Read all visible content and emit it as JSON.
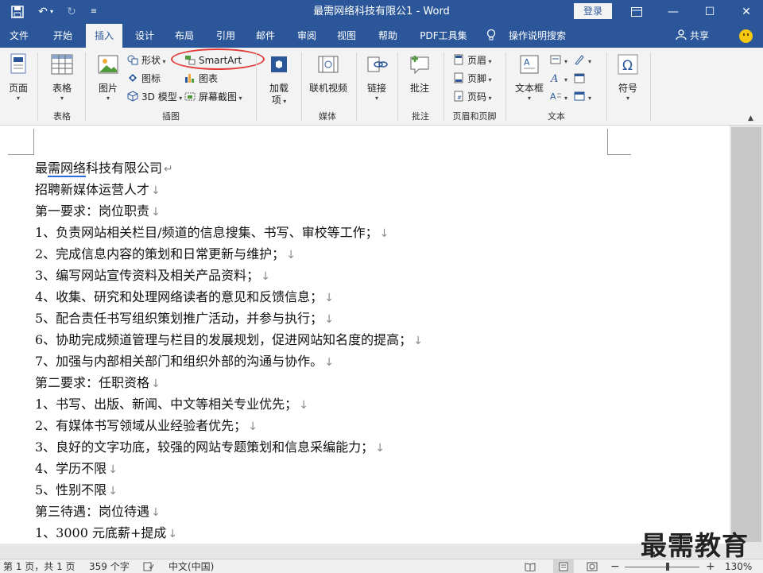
{
  "titlebar": {
    "title": "最需网络科技有限公1  -  Word",
    "login": "登录"
  },
  "tabs": [
    "文件",
    "开始",
    "插入",
    "设计",
    "布局",
    "引用",
    "邮件",
    "审阅",
    "视图",
    "帮助",
    "PDF工具集"
  ],
  "tell_me": "操作说明搜索",
  "share": "共享",
  "ribbon": {
    "pages": "页面",
    "table": "表格",
    "table_group": "表格",
    "pictures": "图片",
    "shapes": "形状",
    "icons": "图标",
    "model3d": "3D 模型",
    "smartart": "SmartArt",
    "chart": "图表",
    "screenshot": "屏幕截图",
    "illustrations_group": "插图",
    "addins_1": "加载",
    "addins_2": "项",
    "online_video": "联机视频",
    "media_group": "媒体",
    "link": "链接",
    "comment": "批注",
    "comments_group": "批注",
    "header": "页眉",
    "footer": "页脚",
    "page_number": "页码",
    "hf_group": "页眉和页脚",
    "textbox": "文本框",
    "text_group": "文本",
    "symbol": "符号",
    "accent": "#2b579a",
    "highlight": "#e23b3b"
  },
  "document": {
    "lines": [
      "最需网络科技有限公司",
      "招聘新媒体运营人才",
      "第一要求：岗位职责",
      "1、负责网站相关栏目/频道的信息搜集、书写、审校等工作；",
      "2、完成信息内容的策划和日常更新与维护；",
      "3、编写网站宣传资料及相关产品资料；",
      "4、收集、研究和处理网络读者的意见和反馈信息；",
      "5、配合责任书写组织策划推广活动，并参与执行；",
      "6、协助完成频道管理与栏目的发展规划，促进网站知名度的提高；",
      "7、加强与内部相关部门和组织外部的沟通与协作。",
      "第二要求：任职资格",
      "1、书写、出版、新闻、中文等相关专业优先；",
      "2、有媒体书写领域从业经验者优先；",
      "3、良好的文字功底，较强的网站专题策划和信息采编能力；",
      "4、学历不限",
      "5、性别不限",
      "第三待遇：岗位待遇",
      "1、3000 元底薪+提成"
    ],
    "first_mark": "↵",
    "line_mark": "↓"
  },
  "status": {
    "page": "第 1 页，共 1 页",
    "words": "359 个字",
    "language": "中文(中国)",
    "zoom": "130%"
  },
  "watermark": "最需教育"
}
